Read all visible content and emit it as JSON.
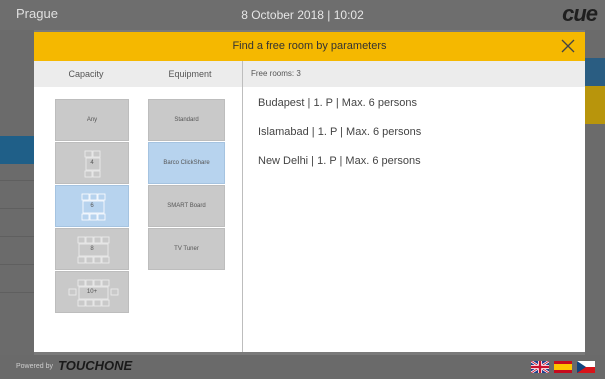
{
  "header": {
    "city": "Prague",
    "datetime": "8 October 2018  |  10:02",
    "logo": "cue"
  },
  "modal": {
    "title": "Find a free room by parameters",
    "close_icon": "close-icon",
    "capacity_header": "Capacity",
    "equipment_header": "Equipment",
    "capacity_options": [
      {
        "label": "Any",
        "selected": false
      },
      {
        "label": "4",
        "selected": false
      },
      {
        "label": "6",
        "selected": true
      },
      {
        "label": "8",
        "selected": false
      },
      {
        "label": "10+",
        "selected": false
      }
    ],
    "equipment_options": [
      {
        "label": "Standard",
        "selected": false
      },
      {
        "label": "Barco ClickShare",
        "selected": true
      },
      {
        "label": "SMART Board",
        "selected": false
      },
      {
        "label": "TV Tuner",
        "selected": false
      }
    ],
    "free_rooms_label": "Free rooms: 3",
    "rooms": [
      "Budapest | 1. P | Max. 6 persons",
      "Islamabad | 1. P | Max. 6 persons",
      "New Delhi | 1. P | Max. 6 persons"
    ]
  },
  "footer": {
    "powered_label": "Powered by",
    "brand": "TOUCHONE",
    "flags": [
      "uk-flag-icon",
      "spain-flag-icon",
      "czech-flag-icon"
    ]
  },
  "colors": {
    "accent": "#f5b800",
    "selected": "#b7d3ee",
    "option_bg": "#c9c9c9"
  }
}
